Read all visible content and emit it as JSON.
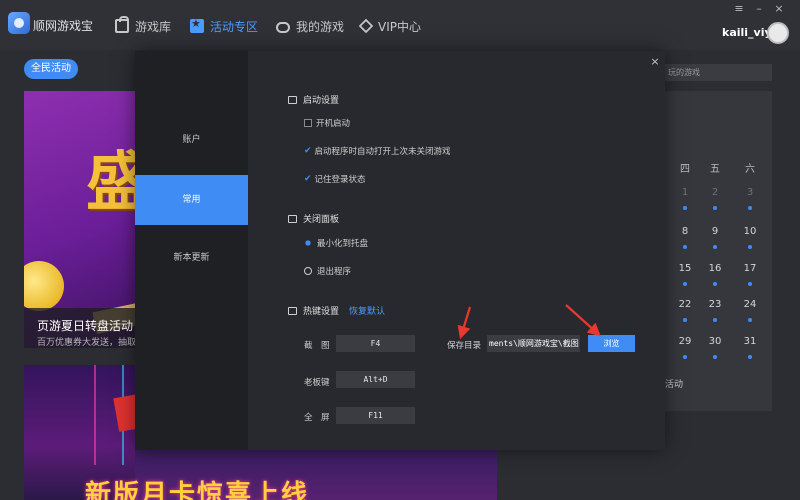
{
  "app": {
    "title": "顺网游戏宝"
  },
  "nav": [
    {
      "label": "游戏库",
      "icon": "store-icon"
    },
    {
      "label": "活动专区",
      "icon": "event-icon",
      "active": true
    },
    {
      "label": "我的游戏",
      "icon": "gamepad-icon"
    },
    {
      "label": "VIP中心",
      "icon": "diamond-icon"
    }
  ],
  "user": {
    "name": "kaili_viyo"
  },
  "background": {
    "tag": "全民活动",
    "banner1": {
      "title": "页游夏日转盘活动",
      "subtitle": "百万优惠券大发送，抽取"
    },
    "banner2": {
      "title": "新版月卡惊喜上线"
    },
    "search_hint": "玩的游戏",
    "calendar": {
      "weekdays": [
        "四",
        "五",
        "六"
      ],
      "rows": [
        [
          "1",
          "2",
          "3"
        ],
        [
          "8",
          "9",
          "10"
        ],
        [
          "15",
          "16",
          "17"
        ],
        [
          "22",
          "23",
          "24"
        ],
        [
          "29",
          "30",
          "31"
        ]
      ],
      "event_label": "活动"
    }
  },
  "dialog": {
    "close": "×",
    "sidebar": [
      {
        "label": "账户"
      },
      {
        "label": "常用",
        "active": true
      },
      {
        "label": "新本更新"
      }
    ],
    "startup": {
      "title": "启动设置",
      "options": [
        {
          "label": "开机启动",
          "checked": false
        },
        {
          "label": "启动程序时自动打开上次未关闭游戏",
          "checked": true
        },
        {
          "label": "记住登录状态",
          "checked": true
        }
      ]
    },
    "close_panel": {
      "title": "关闭面板",
      "options": [
        {
          "label": "最小化到托盘",
          "selected": true
        },
        {
          "label": "退出程序",
          "selected": false
        }
      ]
    },
    "hotkeys": {
      "title": "热键设置",
      "restore_link": "恢复默认",
      "screenshot_label": "截　图",
      "screenshot_key": "F4",
      "boss_label": "老板键",
      "boss_key": "Alt+D",
      "fullscreen_label": "全　屏",
      "fullscreen_key": "F11",
      "save_dir_label": "保存目录",
      "save_dir_value": "ments\\顺网游戏宝\\截图",
      "browse_label": "浏览"
    }
  },
  "colors": {
    "accent": "#3f8cf5",
    "annotation": "#e8392f"
  }
}
